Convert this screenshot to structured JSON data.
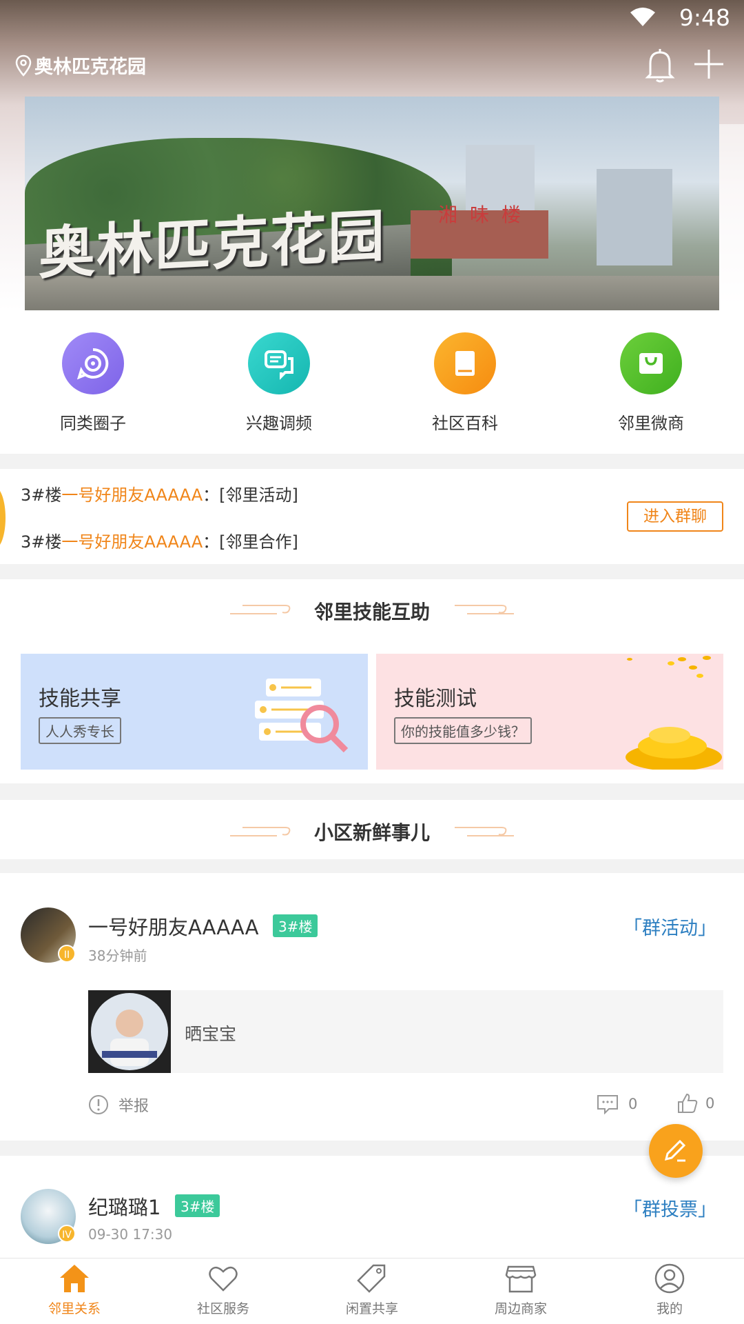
{
  "status_bar": {
    "time": "9:48"
  },
  "header": {
    "location": "奥林匹克花园"
  },
  "banner": {
    "sign_text": "奥林匹克花园",
    "shop_text": "湘味楼"
  },
  "quick_menu": [
    {
      "label": "同类圈子",
      "icon": "target-circle-icon",
      "color": "#8f77f0"
    },
    {
      "label": "兴趣调频",
      "icon": "chat-bubbles-icon",
      "color": "#22c8c0"
    },
    {
      "label": "社区百科",
      "icon": "book-icon",
      "color": "#f7a21b"
    },
    {
      "label": "邻里微商",
      "icon": "shopping-bag-icon",
      "color": "#55c22b"
    }
  ],
  "group_chat": {
    "lines": [
      {
        "building": "3#楼",
        "name": "一号好朋友AAAAA",
        "sep": "：",
        "msg": "[邻里活动]"
      },
      {
        "building": "3#楼",
        "name": "一号好朋友AAAAA",
        "sep": "：",
        "msg": "[邻里合作]"
      }
    ],
    "join_label": "进入群聊"
  },
  "skills": {
    "title": "邻里技能互助",
    "cards": [
      {
        "title": "技能共享",
        "tag": "人人秀专长",
        "bg": "#cfe0fb"
      },
      {
        "title": "技能测试",
        "tag": "你的技能值多少钱？",
        "bg": "#fde1e3"
      }
    ]
  },
  "news": {
    "title": "小区新鲜事儿",
    "posts": [
      {
        "user": "一号好朋友AAAAA",
        "level": "II",
        "building": "3#楼",
        "time": "38分钟前",
        "type": "「群活动」",
        "share_text": "晒宝宝",
        "report": "举报",
        "comments": "0",
        "likes": "0"
      },
      {
        "user": "纪璐璐1",
        "level": "IV",
        "building": "3#楼",
        "time": "09-30 17:30",
        "type": "「群投票」"
      }
    ]
  },
  "tabs": [
    {
      "label": "邻里关系",
      "active": true
    },
    {
      "label": "社区服务",
      "active": false
    },
    {
      "label": "闲置共享",
      "active": false
    },
    {
      "label": "周边商家",
      "active": false
    },
    {
      "label": "我的",
      "active": false
    }
  ],
  "colors": {
    "accent": "#f08519",
    "link": "#2d7fc1",
    "badge": "#3cc99a"
  }
}
